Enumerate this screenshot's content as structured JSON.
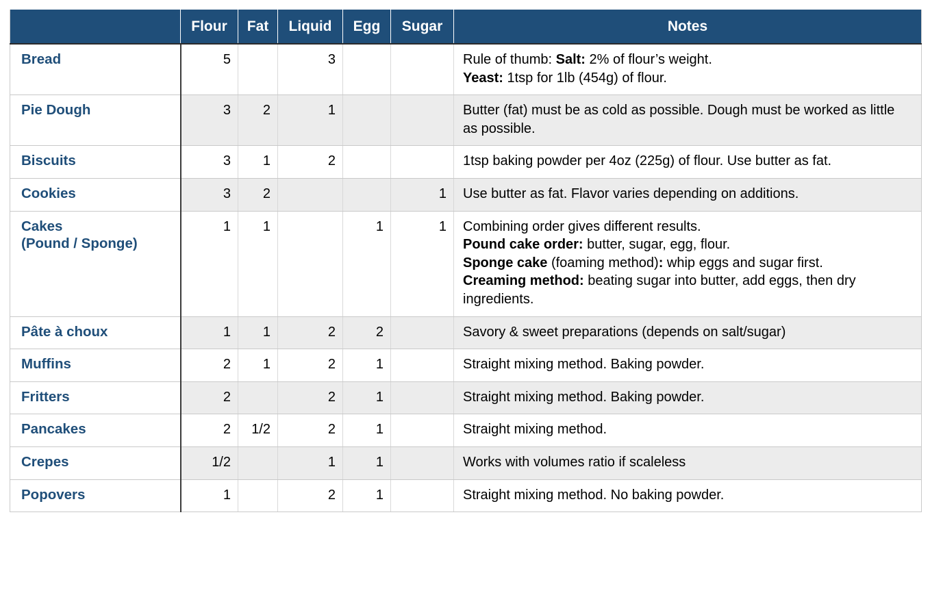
{
  "table": {
    "columns": [
      {
        "key": "name",
        "label": ""
      },
      {
        "key": "flour",
        "label": "Flour"
      },
      {
        "key": "fat",
        "label": "Fat"
      },
      {
        "key": "liquid",
        "label": "Liquid"
      },
      {
        "key": "egg",
        "label": "Egg"
      },
      {
        "key": "sugar",
        "label": "Sugar"
      },
      {
        "key": "notes",
        "label": "Notes"
      }
    ],
    "colors": {
      "header_background": "#1f4e79",
      "header_text": "#ffffff",
      "row_label_text": "#1f4e79",
      "stripe_background": "#ececec",
      "row_background": "#ffffff",
      "grid_line": "#c9c9c9"
    },
    "rows": [
      {
        "name": "Bread",
        "flour": "5",
        "fat": "",
        "liquid": "3",
        "egg": "",
        "sugar": "",
        "notes_lines": [
          [
            {
              "t": "Rule of thumb: ",
              "b": false
            },
            {
              "t": "Salt:",
              "b": true
            },
            {
              "t": " 2% of flour’s weight.",
              "b": false
            }
          ],
          [
            {
              "t": "Yeast:",
              "b": true
            },
            {
              "t": " 1tsp for 1lb (454g) of flour.",
              "b": false
            }
          ]
        ]
      },
      {
        "name": "Pie Dough",
        "flour": "3",
        "fat": "2",
        "liquid": "1",
        "egg": "",
        "sugar": "",
        "notes_lines": [
          [
            {
              "t": "Butter (fat) must be as cold as possible. Dough must be worked as little as possible.",
              "b": false
            }
          ]
        ]
      },
      {
        "name": "Biscuits",
        "flour": "3",
        "fat": "1",
        "liquid": "2",
        "egg": "",
        "sugar": "",
        "notes_lines": [
          [
            {
              "t": "1tsp baking powder per 4oz (225g) of flour. Use butter as fat.",
              "b": false
            }
          ]
        ]
      },
      {
        "name": "Cookies",
        "flour": "3",
        "fat": "2",
        "liquid": "",
        "egg": "",
        "sugar": "1",
        "notes_lines": [
          [
            {
              "t": "Use butter as fat. Flavor varies depending on additions.",
              "b": false
            }
          ]
        ]
      },
      {
        "name": "Cakes\n(Pound / Sponge)",
        "flour": "1",
        "fat": "1",
        "liquid": "",
        "egg": "1",
        "sugar": "1",
        "notes_lines": [
          [
            {
              "t": "Combining order gives different results.",
              "b": false
            }
          ],
          [
            {
              "t": "Pound cake order:",
              "b": true
            },
            {
              "t": " butter, sugar, egg, flour.",
              "b": false
            }
          ],
          [
            {
              "t": "Sponge cake",
              "b": true
            },
            {
              "t": " (foaming method)",
              "b": false
            },
            {
              "t": ":",
              "b": true
            },
            {
              "t": " whip eggs and sugar first.",
              "b": false
            }
          ],
          [
            {
              "t": "Creaming method:",
              "b": true
            },
            {
              "t": " beating sugar into butter, add eggs, then dry ingredients.",
              "b": false
            }
          ]
        ]
      },
      {
        "name": "Pâte à choux",
        "flour": "1",
        "fat": "1",
        "liquid": "2",
        "egg": "2",
        "sugar": "",
        "notes_lines": [
          [
            {
              "t": "Savory & sweet preparations (depends on salt/sugar)",
              "b": false
            }
          ]
        ]
      },
      {
        "name": "Muffins",
        "flour": "2",
        "fat": "1",
        "liquid": "2",
        "egg": "1",
        "sugar": "",
        "notes_lines": [
          [
            {
              "t": "Straight mixing method. Baking powder.",
              "b": false
            }
          ]
        ]
      },
      {
        "name": "Fritters",
        "flour": "2",
        "fat": "",
        "liquid": "2",
        "egg": "1",
        "sugar": "",
        "notes_lines": [
          [
            {
              "t": "Straight mixing method. Baking powder.",
              "b": false
            }
          ]
        ]
      },
      {
        "name": "Pancakes",
        "flour": "2",
        "fat": "1/2",
        "liquid": "2",
        "egg": "1",
        "sugar": "",
        "notes_lines": [
          [
            {
              "t": "Straight mixing method.",
              "b": false
            }
          ]
        ]
      },
      {
        "name": "Crepes",
        "flour": "1/2",
        "fat": "",
        "liquid": "1",
        "egg": "1",
        "sugar": "",
        "notes_lines": [
          [
            {
              "t": "Works with volumes ratio if scaleless",
              "b": false
            }
          ]
        ]
      },
      {
        "name": "Popovers",
        "flour": "1",
        "fat": "",
        "liquid": "2",
        "egg": "1",
        "sugar": "",
        "notes_lines": [
          [
            {
              "t": "Straight mixing method. No baking powder.",
              "b": false
            }
          ]
        ]
      }
    ]
  }
}
